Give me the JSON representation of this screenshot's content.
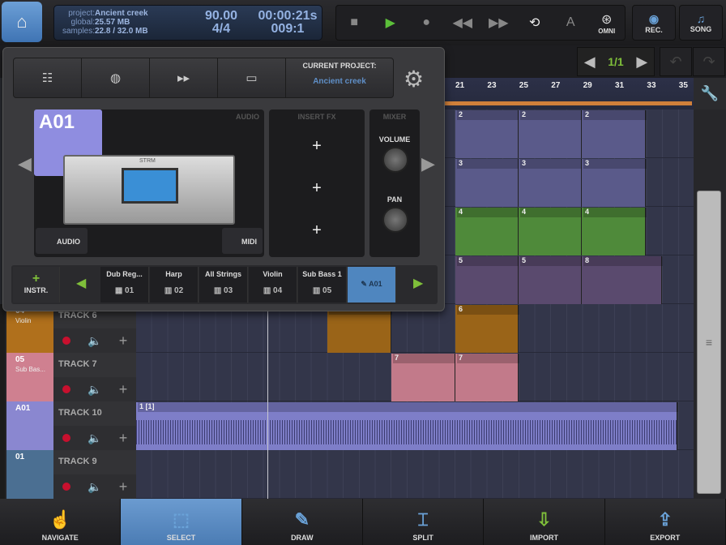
{
  "header": {
    "home_icon": "home-icon",
    "lcd": {
      "project_label": "project:",
      "project": "Ancient creek",
      "global_label": "global:",
      "global": "25.57 MB",
      "samples_label": "samples:",
      "samples": "22.8 / 32.0 MB",
      "tempo": "90.00",
      "signature": "4/4",
      "time": "00:00:21s",
      "position": "009:1"
    },
    "transport": {
      "omni_label": "OMNI",
      "a_label": "A"
    },
    "rec_label": "REC.",
    "song_label": "SONG"
  },
  "pager": {
    "value": "1/1"
  },
  "ruler": {
    "ticks": [
      "21",
      "23",
      "25",
      "27",
      "29",
      "31",
      "33",
      "35"
    ]
  },
  "clips": [
    {
      "lane": 0,
      "labels": [
        "2",
        "2",
        "2"
      ]
    },
    {
      "lane": 1,
      "labels": [
        "3",
        "3",
        "3"
      ]
    },
    {
      "lane": 2,
      "labels": [
        "4",
        "4",
        "4"
      ]
    },
    {
      "lane": 3,
      "labels": [
        "5",
        "5",
        "8"
      ]
    },
    {
      "lane": 4,
      "labels": [
        "",
        "6"
      ]
    },
    {
      "lane": 5,
      "labels": [
        "7",
        "7"
      ]
    },
    {
      "lane": 6,
      "labels": [
        "1 [1]"
      ]
    }
  ],
  "tracks": [
    {
      "name": "TRACK 6",
      "inst": "04",
      "sub": "Violin",
      "color": "#b0701c"
    },
    {
      "name": "TRACK 7",
      "inst": "05",
      "sub": "Sub Bas...",
      "color": "#cf8090"
    },
    {
      "name": "TRACK 10",
      "inst": "A01",
      "sub": "",
      "color": "#8a87d0"
    },
    {
      "name": "TRACK 9",
      "inst": "01",
      "sub": "",
      "color": "#4b6f92"
    }
  ],
  "panel": {
    "current_project_label": "CURRENT PROJECT:",
    "current_project": "Ancient creek",
    "instrument_name": "A01",
    "audio_title": "AUDIO",
    "insert_fx_title": "INSERT FX",
    "mixer_title": "MIXER",
    "volume_label": "VOLUME",
    "pan_label": "PAN",
    "audio_btn": "AUDIO",
    "midi_btn": "MIDI",
    "add_instr": "INSTR.",
    "device_label": "STRM",
    "instruments": [
      {
        "name": "Dub Reg...",
        "num": "01"
      },
      {
        "name": "Harp",
        "num": "02"
      },
      {
        "name": "All Strings",
        "num": "03"
      },
      {
        "name": "Violin",
        "num": "04"
      },
      {
        "name": "Sub Bass 1",
        "num": "05"
      },
      {
        "name": "",
        "num": "A01"
      }
    ]
  },
  "bottom": {
    "items": [
      "NAVIGATE",
      "SELECT",
      "DRAW",
      "SPLIT",
      "IMPORT",
      "EXPORT"
    ],
    "active": "SELECT"
  },
  "colors": {
    "accent": "#5b8ec6",
    "loop": "#d0803a",
    "green": "#7fbf3a"
  }
}
